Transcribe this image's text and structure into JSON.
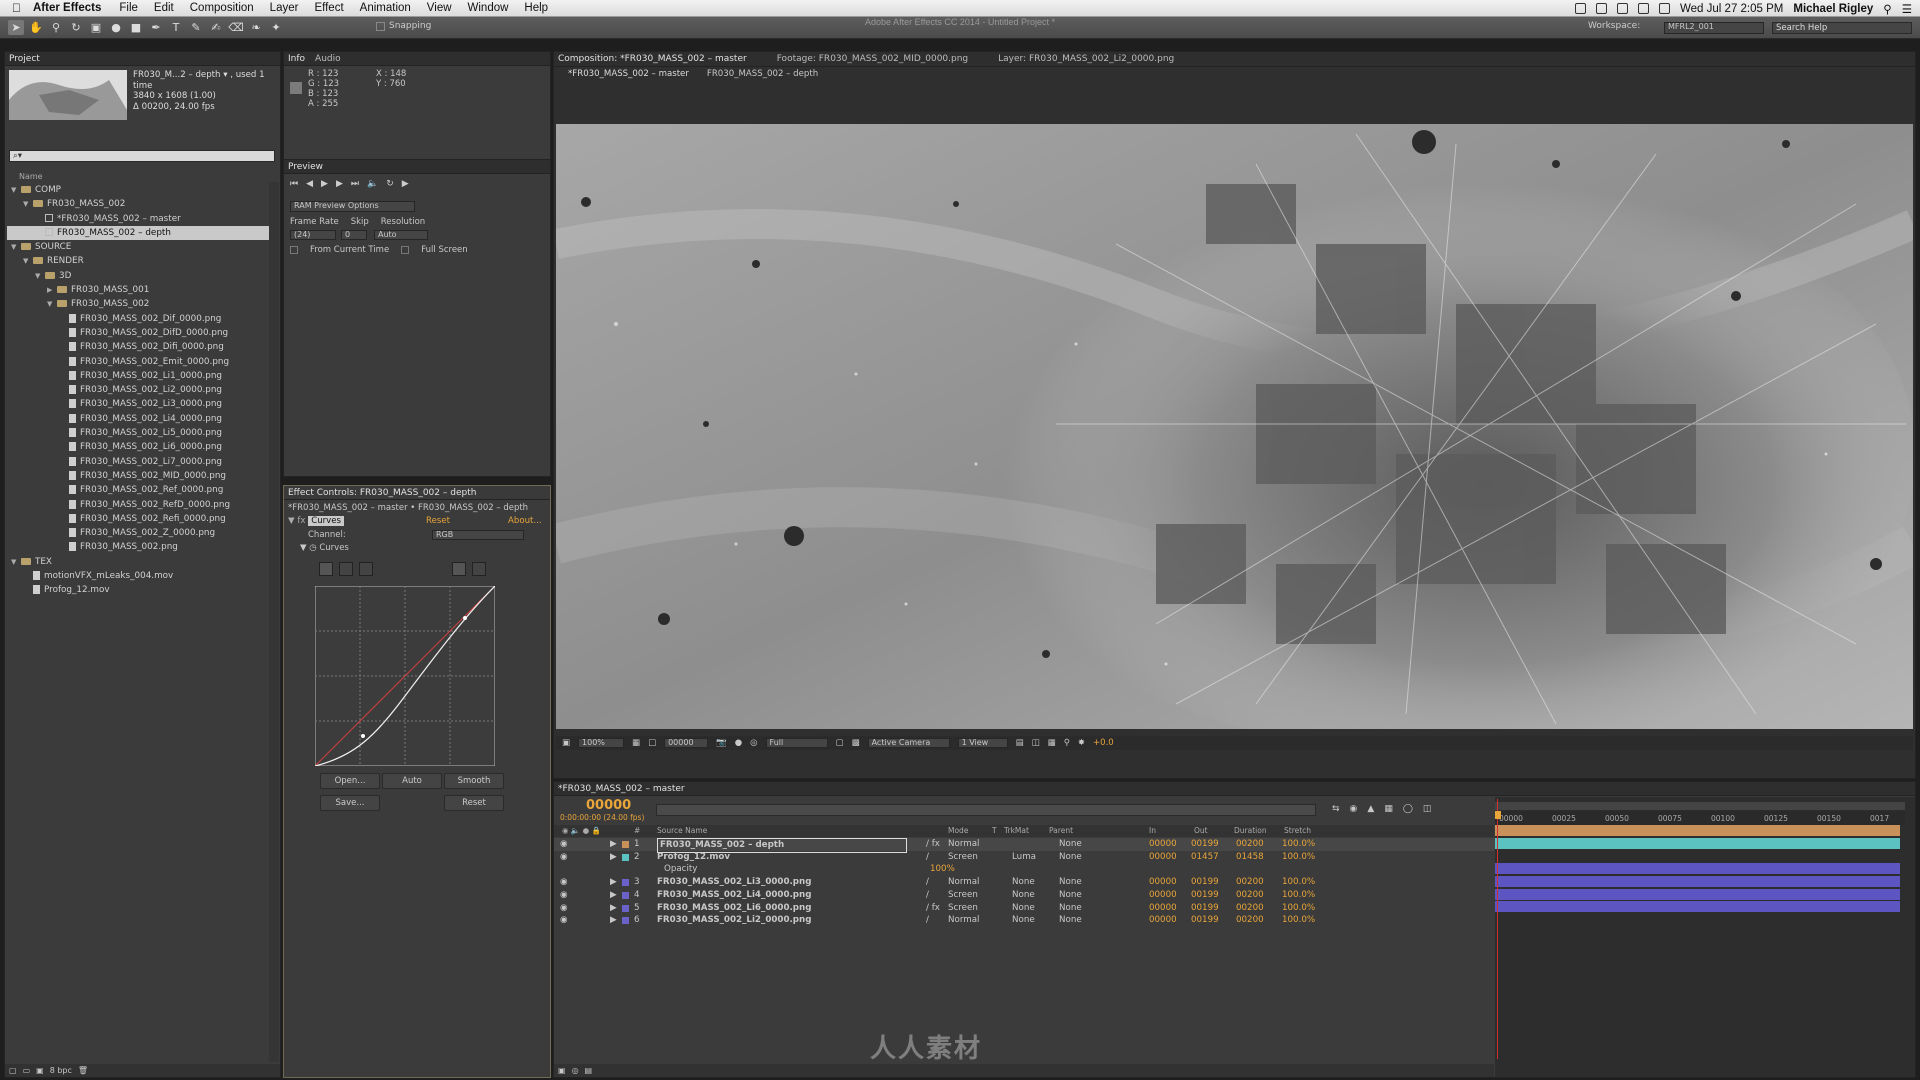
{
  "menubar": {
    "app_name": "After Effects",
    "items": [
      "File",
      "Edit",
      "Composition",
      "Layer",
      "Effect",
      "Animation",
      "View",
      "Window",
      "Help"
    ],
    "clock": "Wed Jul 27  2:05 PM",
    "user": "Michael Rigley"
  },
  "window_title": "Adobe After Effects CC 2014 - Untitled Project *",
  "toolbar": {
    "snapping_label": "Snapping",
    "workspace_label": "Workspace:",
    "workspace_value": "MFRL2_001",
    "search_help_placeholder": "Search Help"
  },
  "project_panel": {
    "tab_label": "Project",
    "thumb_title": "FR030_M...2 – depth ▾ , used 1 time",
    "thumb_dims": "3840 x 1608 (1.00)",
    "thumb_duration": "Δ 00200, 24.00 fps",
    "search_placeholder": "⌕▾",
    "name_header": "Name",
    "items": [
      {
        "label": "COMP",
        "type": "folder",
        "depth": 0,
        "twirl": "▼"
      },
      {
        "label": "FR030_MASS_002",
        "type": "folder",
        "depth": 1,
        "twirl": "▼"
      },
      {
        "label": "*FR030_MASS_002 – master",
        "type": "comp",
        "depth": 2,
        "twirl": ""
      },
      {
        "label": "FR030_MASS_002 – depth",
        "type": "comp",
        "depth": 2,
        "twirl": "",
        "selected": true
      },
      {
        "label": "SOURCE",
        "type": "folder",
        "depth": 0,
        "twirl": "▼"
      },
      {
        "label": "RENDER",
        "type": "folder",
        "depth": 1,
        "twirl": "▼"
      },
      {
        "label": "3D",
        "type": "folder",
        "depth": 2,
        "twirl": "▼"
      },
      {
        "label": "FR030_MASS_001",
        "type": "folder",
        "depth": 3,
        "twirl": "▶"
      },
      {
        "label": "FR030_MASS_002",
        "type": "folder",
        "depth": 3,
        "twirl": "▼"
      },
      {
        "label": "FR030_MASS_002_Dif_0000.png",
        "type": "file",
        "depth": 4,
        "twirl": ""
      },
      {
        "label": "FR030_MASS_002_DifD_0000.png",
        "type": "file",
        "depth": 4,
        "twirl": ""
      },
      {
        "label": "FR030_MASS_002_Difi_0000.png",
        "type": "file",
        "depth": 4,
        "twirl": ""
      },
      {
        "label": "FR030_MASS_002_Emit_0000.png",
        "type": "file",
        "depth": 4,
        "twirl": ""
      },
      {
        "label": "FR030_MASS_002_Li1_0000.png",
        "type": "file",
        "depth": 4,
        "twirl": ""
      },
      {
        "label": "FR030_MASS_002_Li2_0000.png",
        "type": "file",
        "depth": 4,
        "twirl": ""
      },
      {
        "label": "FR030_MASS_002_Li3_0000.png",
        "type": "file",
        "depth": 4,
        "twirl": ""
      },
      {
        "label": "FR030_MASS_002_Li4_0000.png",
        "type": "file",
        "depth": 4,
        "twirl": ""
      },
      {
        "label": "FR030_MASS_002_Li5_0000.png",
        "type": "file",
        "depth": 4,
        "twirl": ""
      },
      {
        "label": "FR030_MASS_002_Li6_0000.png",
        "type": "file",
        "depth": 4,
        "twirl": ""
      },
      {
        "label": "FR030_MASS_002_Li7_0000.png",
        "type": "file",
        "depth": 4,
        "twirl": ""
      },
      {
        "label": "FR030_MASS_002_MID_0000.png",
        "type": "file",
        "depth": 4,
        "twirl": ""
      },
      {
        "label": "FR030_MASS_002_Ref_0000.png",
        "type": "file",
        "depth": 4,
        "twirl": ""
      },
      {
        "label": "FR030_MASS_002_RefD_0000.png",
        "type": "file",
        "depth": 4,
        "twirl": ""
      },
      {
        "label": "FR030_MASS_002_Refi_0000.png",
        "type": "file",
        "depth": 4,
        "twirl": ""
      },
      {
        "label": "FR030_MASS_002_Z_0000.png",
        "type": "file",
        "depth": 4,
        "twirl": ""
      },
      {
        "label": "FR030_MASS_002.png",
        "type": "file",
        "depth": 4,
        "twirl": ""
      },
      {
        "label": "TEX",
        "type": "folder",
        "depth": 0,
        "twirl": "▼"
      },
      {
        "label": "motionVFX_mLeaks_004.mov",
        "type": "file",
        "depth": 1,
        "twirl": ""
      },
      {
        "label": "Profog_12.mov",
        "type": "file",
        "depth": 1,
        "twirl": ""
      }
    ],
    "bpc_label": "8 bpc"
  },
  "info_panel": {
    "tabs": [
      "Info",
      "Audio"
    ],
    "r": "R : 123",
    "g": "G : 123",
    "b": "B : 123",
    "a": "A : 255",
    "x": "X : 148",
    "y": "Y : 760"
  },
  "preview_panel": {
    "tab_label": "Preview",
    "ram_options": "RAM Preview Options",
    "frame_rate_label": "Frame Rate",
    "skip_label": "Skip",
    "resolution_label": "Resolution",
    "frame_rate_value": "(24)",
    "skip_value": "0",
    "resolution_value": "Auto",
    "from_current_time": "From Current Time",
    "full_screen": "Full Screen"
  },
  "effect_controls": {
    "tab_label": "Effect Controls: FR030_MASS_002 – depth",
    "breadcrumb": "*FR030_MASS_002 – master • FR030_MASS_002 – depth",
    "effect_name": "Curves",
    "reset_label": "Reset",
    "about_label": "About...",
    "channel_label": "Channel:",
    "channel_value": "RGB",
    "curves_sub": "Curves",
    "buttons": {
      "open": "Open...",
      "auto": "Auto",
      "smooth": "Smooth",
      "save": "Save...",
      "reset": "Reset"
    }
  },
  "composition_panel": {
    "tab_label": "Composition: *FR030_MASS_002 – master",
    "footage_tab": "Footage: FR030_MASS_002_MID_0000.png",
    "layer_tab": "Layer: FR030_MASS_002_Li2_0000.png",
    "breadcrumb_master": "*FR030_MASS_002 – master",
    "breadcrumb_depth": "FR030_MASS_002 – depth",
    "zoom": "100%",
    "timecode": "00000",
    "resolution": "Full",
    "camera": "Active Camera",
    "views": "1 View",
    "exposure": "+0.0"
  },
  "timeline": {
    "tab_label": "*FR030_MASS_002 – master",
    "current_time": "00000",
    "current_time_sub": "0:00:00:00 (24.00 fps)",
    "headers": {
      "source_name": "Source Name",
      "mode": "Mode",
      "t": "T",
      "trkmat": "TrkMat",
      "parent": "Parent",
      "in": "In",
      "out": "Out",
      "duration": "Duration",
      "stretch": "Stretch"
    },
    "layers": [
      {
        "num": "1",
        "name": "FR030_MASS_002 – depth",
        "mode": "Normal",
        "trkmat": "",
        "parent": "None",
        "in": "00000",
        "out": "00199",
        "duration": "00200",
        "stretch": "100.0%",
        "label_color": "#c8915a",
        "bar_color": "#c8915a",
        "fx": true
      },
      {
        "num": "2",
        "name": "Profog_12.mov",
        "mode": "Screen",
        "trkmat": "Luma",
        "parent": "None",
        "in": "00000",
        "out": "01457",
        "duration": "01458",
        "stretch": "100.0%",
        "label_color": "#5bc1c1",
        "bar_color": "#5bc1c1",
        "fx": false
      },
      {
        "num": "3",
        "name": "FR030_MASS_002_Li3_0000.png",
        "mode": "Normal",
        "trkmat": "None",
        "parent": "None",
        "in": "00000",
        "out": "00199",
        "duration": "00200",
        "stretch": "100.0%",
        "label_color": "#6a62c9",
        "bar_color": "#5d56c2",
        "fx": false
      },
      {
        "num": "4",
        "name": "FR030_MASS_002_Li4_0000.png",
        "mode": "Screen",
        "trkmat": "None",
        "parent": "None",
        "in": "00000",
        "out": "00199",
        "duration": "00200",
        "stretch": "100.0%",
        "label_color": "#6a62c9",
        "bar_color": "#5d56c2",
        "fx": false
      },
      {
        "num": "5",
        "name": "FR030_MASS_002_Li6_0000.png",
        "mode": "Screen",
        "trkmat": "None",
        "parent": "None",
        "in": "00000",
        "out": "00199",
        "duration": "00200",
        "stretch": "100.0%",
        "label_color": "#6a62c9",
        "bar_color": "#5d56c2",
        "fx": true
      },
      {
        "num": "6",
        "name": "FR030_MASS_002_Li2_0000.png",
        "mode": "Normal",
        "trkmat": "None",
        "parent": "None",
        "in": "00000",
        "out": "00199",
        "duration": "00200",
        "stretch": "100.0%",
        "label_color": "#6a62c9",
        "bar_color": "#5d56c2",
        "fx": false
      }
    ],
    "opacity_label": "Opacity",
    "opacity_value": "100%",
    "ruler_ticks": [
      "00000",
      "00025",
      "00050",
      "00075",
      "00100",
      "00125",
      "00150",
      "0017"
    ]
  },
  "watermark": "人人素材"
}
